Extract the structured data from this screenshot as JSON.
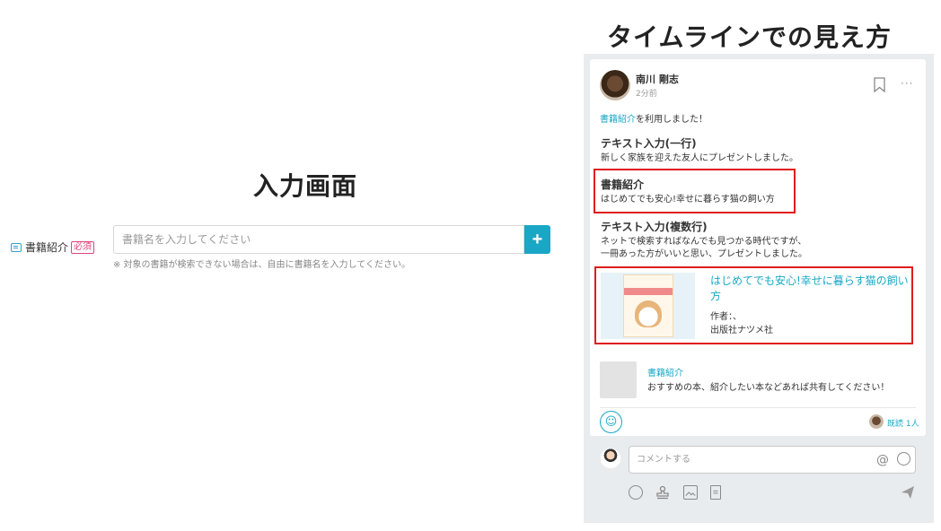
{
  "left": {
    "title": "入力画面",
    "field_label": "書籍紹介",
    "required_badge": "必須",
    "input_placeholder": "書籍名を入力してください",
    "add_button": "+",
    "note": "※ 対象の書籍が検索できない場合は、自由に書籍名を入力してください。"
  },
  "right": {
    "title": "タイムラインでの見え方",
    "post": {
      "author": "南川 剛志",
      "time": "2分前",
      "more": "···",
      "used_link": "書籍紹介",
      "used_suffix": "を利用しました！",
      "sections": [
        {
          "title": "テキスト入力(一行)",
          "body": "新しく家族を迎えた友人にプレゼントしました。"
        },
        {
          "title": "書籍紹介",
          "body": "はじめてでも安心!幸せに暮らす猫の飼い方"
        },
        {
          "title": "テキスト入力(複数行)",
          "body_line1": "ネットで検索すればなんでも見つかる時代ですが、",
          "body_line2": "一冊あった方がいいと思い、プレゼントしました。"
        }
      ],
      "book": {
        "title": "はじめてでも安心!幸せに暮らす猫の飼い方",
        "author": "作者：、",
        "publisher": "出版社ナツメ社"
      },
      "reference": {
        "name": "書籍紹介",
        "description": "おすすめの本、紹介したい本などあれば共有してください！"
      },
      "read_count": "既読 1人",
      "comment_placeholder": "コメントする",
      "at_symbol": "@"
    }
  },
  "colors": {
    "accent": "#1aa7c6",
    "highlight": "#e01c1c",
    "required": "#e0457b"
  },
  "icons": [
    "book-icon",
    "plus-icon",
    "bookmark-icon",
    "more-icon",
    "reaction-add-icon",
    "at-icon",
    "smile-icon",
    "stamp-icon",
    "image-icon",
    "document-icon",
    "send-icon"
  ]
}
